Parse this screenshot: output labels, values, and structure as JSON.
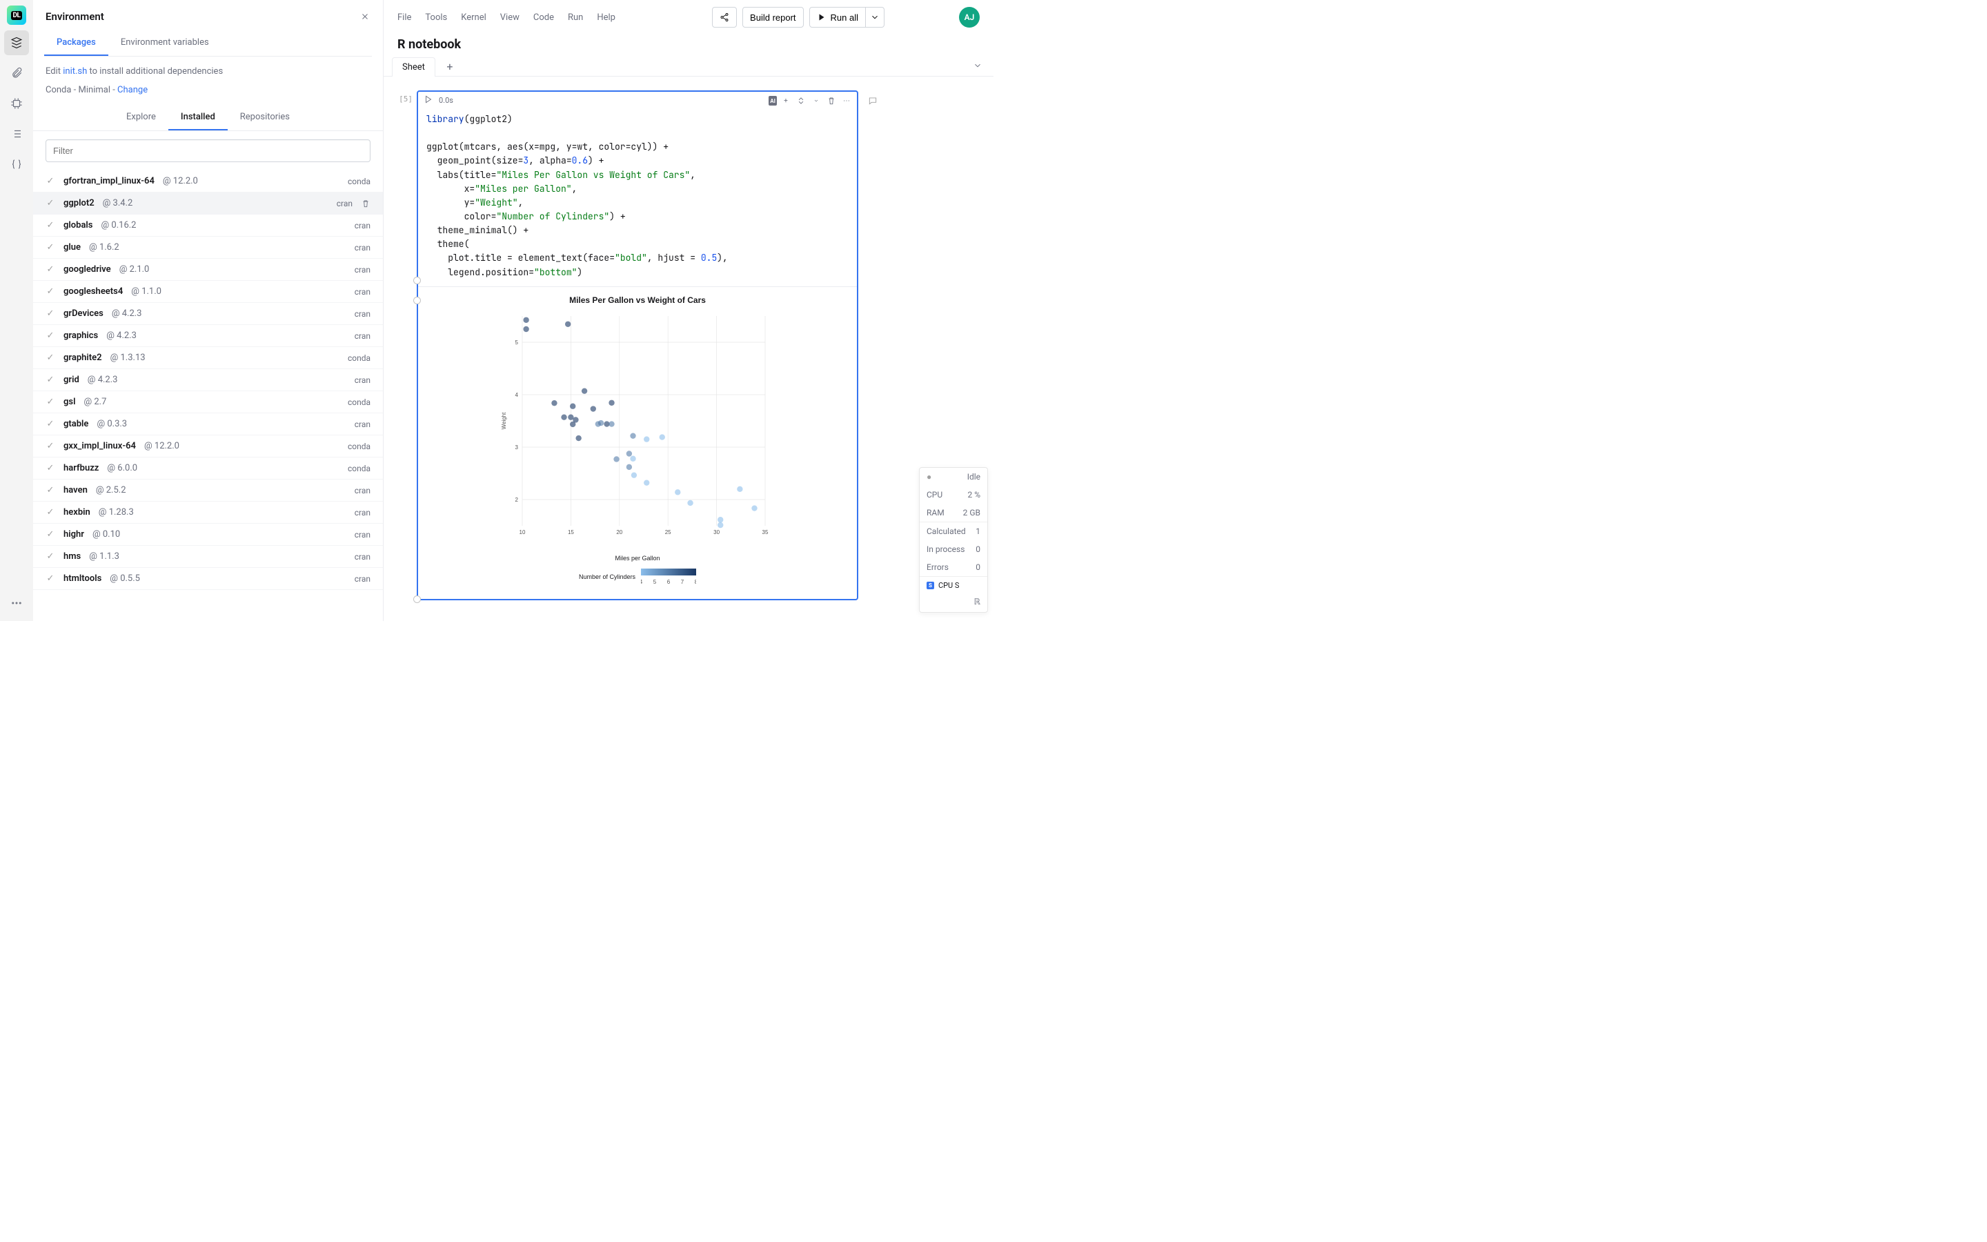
{
  "rail": {
    "logo_text": "DL"
  },
  "env": {
    "title": "Environment",
    "tabs": [
      "Packages",
      "Environment variables"
    ],
    "hint_pre": "Edit ",
    "hint_link": "init.sh",
    "hint_post": " to install additional dependencies",
    "conda_text": "Conda - Minimal - ",
    "conda_change": "Change",
    "subtabs": [
      "Explore",
      "Installed",
      "Repositories"
    ],
    "filter_placeholder": "Filter",
    "packages": [
      {
        "name": "gfortran_impl_linux-64",
        "ver": "12.2.0",
        "src": "conda"
      },
      {
        "name": "ggplot2",
        "ver": "3.4.2",
        "src": "cran",
        "hover": true
      },
      {
        "name": "globals",
        "ver": "0.16.2",
        "src": "cran"
      },
      {
        "name": "glue",
        "ver": "1.6.2",
        "src": "cran"
      },
      {
        "name": "googledrive",
        "ver": "2.1.0",
        "src": "cran"
      },
      {
        "name": "googlesheets4",
        "ver": "1.1.0",
        "src": "cran"
      },
      {
        "name": "grDevices",
        "ver": "4.2.3",
        "src": "cran"
      },
      {
        "name": "graphics",
        "ver": "4.2.3",
        "src": "cran"
      },
      {
        "name": "graphite2",
        "ver": "1.3.13",
        "src": "conda"
      },
      {
        "name": "grid",
        "ver": "4.2.3",
        "src": "cran"
      },
      {
        "name": "gsl",
        "ver": "2.7",
        "src": "conda"
      },
      {
        "name": "gtable",
        "ver": "0.3.3",
        "src": "cran"
      },
      {
        "name": "gxx_impl_linux-64",
        "ver": "12.2.0",
        "src": "conda"
      },
      {
        "name": "harfbuzz",
        "ver": "6.0.0",
        "src": "conda"
      },
      {
        "name": "haven",
        "ver": "2.5.2",
        "src": "cran"
      },
      {
        "name": "hexbin",
        "ver": "1.28.3",
        "src": "cran"
      },
      {
        "name": "highr",
        "ver": "0.10",
        "src": "cran"
      },
      {
        "name": "hms",
        "ver": "1.1.3",
        "src": "cran"
      },
      {
        "name": "htmltools",
        "ver": "0.5.5",
        "src": "cran"
      }
    ]
  },
  "menu": [
    "File",
    "Tools",
    "Kernel",
    "View",
    "Code",
    "Run",
    "Help"
  ],
  "toolbar": {
    "build": "Build report",
    "runall": "Run all"
  },
  "avatar": "AJ",
  "notebook": {
    "title": "R notebook",
    "sheet": "Sheet"
  },
  "cell": {
    "index": "[5]",
    "time": "0.0s",
    "ai": "AI",
    "code_html": "<span class=\"tk-kw\">library</span>(ggplot2)\n\nggplot(mtcars, aes(x=mpg, y=wt, color=cyl)) +\n  geom_point(size=<span class=\"tk-num\">3</span>, alpha=<span class=\"tk-num\">0.6</span>) +\n  labs(title=<span class=\"tk-str\">\"Miles Per Gallon vs Weight of Cars\"</span>,\n       x=<span class=\"tk-str\">\"Miles per Gallon\"</span>,\n       y=<span class=\"tk-str\">\"Weight\"</span>,\n       color=<span class=\"tk-str\">\"Number of Cylinders\"</span>) +\n  theme_minimal() +\n  theme(\n    plot.title = element_text(face=<span class=\"tk-str\">\"bold\"</span>, hjust = <span class=\"tk-num\">0.5</span>),\n    legend.position=<span class=\"tk-str\">\"bottom\"</span>)"
  },
  "chart_data": {
    "type": "scatter",
    "title": "Miles Per Gallon vs Weight of Cars",
    "xlabel": "Miles per Gallon",
    "ylabel": "Weight",
    "color_label": "Number of Cylinders",
    "xlim": [
      10,
      35
    ],
    "ylim": [
      1.5,
      5.5
    ],
    "x_ticks": [
      10,
      15,
      20,
      25,
      30,
      35
    ],
    "y_ticks": [
      2,
      3,
      4,
      5
    ],
    "color_ticks": [
      4,
      5,
      6,
      7,
      8
    ],
    "points": [
      {
        "mpg": 21.0,
        "wt": 2.62,
        "cyl": 6
      },
      {
        "mpg": 21.0,
        "wt": 2.875,
        "cyl": 6
      },
      {
        "mpg": 22.8,
        "wt": 2.32,
        "cyl": 4
      },
      {
        "mpg": 21.4,
        "wt": 3.215,
        "cyl": 6
      },
      {
        "mpg": 18.7,
        "wt": 3.44,
        "cyl": 8
      },
      {
        "mpg": 18.1,
        "wt": 3.46,
        "cyl": 6
      },
      {
        "mpg": 14.3,
        "wt": 3.57,
        "cyl": 8
      },
      {
        "mpg": 24.4,
        "wt": 3.19,
        "cyl": 4
      },
      {
        "mpg": 22.8,
        "wt": 3.15,
        "cyl": 4
      },
      {
        "mpg": 19.2,
        "wt": 3.44,
        "cyl": 6
      },
      {
        "mpg": 17.8,
        "wt": 3.44,
        "cyl": 6
      },
      {
        "mpg": 16.4,
        "wt": 4.07,
        "cyl": 8
      },
      {
        "mpg": 17.3,
        "wt": 3.73,
        "cyl": 8
      },
      {
        "mpg": 15.2,
        "wt": 3.78,
        "cyl": 8
      },
      {
        "mpg": 10.4,
        "wt": 5.25,
        "cyl": 8
      },
      {
        "mpg": 10.4,
        "wt": 5.424,
        "cyl": 8
      },
      {
        "mpg": 14.7,
        "wt": 5.345,
        "cyl": 8
      },
      {
        "mpg": 32.4,
        "wt": 2.2,
        "cyl": 4
      },
      {
        "mpg": 30.4,
        "wt": 1.615,
        "cyl": 4
      },
      {
        "mpg": 33.9,
        "wt": 1.835,
        "cyl": 4
      },
      {
        "mpg": 21.5,
        "wt": 2.465,
        "cyl": 4
      },
      {
        "mpg": 15.5,
        "wt": 3.52,
        "cyl": 8
      },
      {
        "mpg": 15.2,
        "wt": 3.435,
        "cyl": 8
      },
      {
        "mpg": 13.3,
        "wt": 3.84,
        "cyl": 8
      },
      {
        "mpg": 19.2,
        "wt": 3.845,
        "cyl": 8
      },
      {
        "mpg": 27.3,
        "wt": 1.935,
        "cyl": 4
      },
      {
        "mpg": 26.0,
        "wt": 2.14,
        "cyl": 4
      },
      {
        "mpg": 30.4,
        "wt": 1.513,
        "cyl": 4
      },
      {
        "mpg": 15.8,
        "wt": 3.17,
        "cyl": 8
      },
      {
        "mpg": 19.7,
        "wt": 2.77,
        "cyl": 6
      },
      {
        "mpg": 15.0,
        "wt": 3.57,
        "cyl": 8
      },
      {
        "mpg": 21.4,
        "wt": 2.78,
        "cyl": 4
      }
    ]
  },
  "status": {
    "idle": "Idle",
    "cpu_l": "CPU",
    "cpu_v": "2 %",
    "ram_l": "RAM",
    "ram_v": "2 GB",
    "calc_l": "Calculated",
    "calc_v": "1",
    "proc_l": "In process",
    "proc_v": "0",
    "err_l": "Errors",
    "err_v": "0",
    "cpu_item": "CPU S",
    "badge": "S"
  }
}
